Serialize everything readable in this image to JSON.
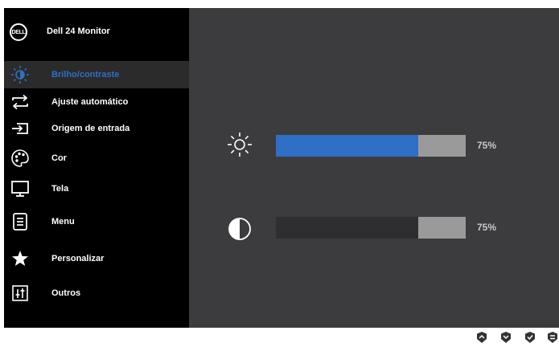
{
  "header": {
    "logo_text": "DELL",
    "model": "Dell 24 Monitor"
  },
  "menu": [
    {
      "label": "Brilho/contraste",
      "icon": "brightness-icon",
      "active": true
    },
    {
      "label": "Ajuste automático",
      "icon": "auto-adjust-icon",
      "active": false
    },
    {
      "label": "Origem de entrada",
      "icon": "input-source-icon",
      "active": false
    },
    {
      "label": "Cor",
      "icon": "color-palette-icon",
      "active": false
    },
    {
      "label": "Tela",
      "icon": "display-icon",
      "active": false
    },
    {
      "label": "Menu",
      "icon": "menu-icon",
      "active": false
    },
    {
      "label": "Personalizar",
      "icon": "star-icon",
      "active": false
    },
    {
      "label": "Outros",
      "icon": "others-icon",
      "active": false
    }
  ],
  "panel": {
    "brightness": {
      "value": 75,
      "label": "75%",
      "icon": "sun-icon"
    },
    "contrast": {
      "value": 75,
      "label": "75%",
      "icon": "contrast-icon"
    }
  },
  "colors": {
    "accent": "#2f6fc5",
    "bar_track": "#9a9a9a",
    "bar_empty": "#2e2e30",
    "panel_bg": "#3c3c3e",
    "menu_bg": "#000000"
  },
  "buttons": [
    {
      "icon": "up-button-icon"
    },
    {
      "icon": "down-button-icon"
    },
    {
      "icon": "ok-button-icon"
    },
    {
      "icon": "back-button-icon"
    }
  ]
}
